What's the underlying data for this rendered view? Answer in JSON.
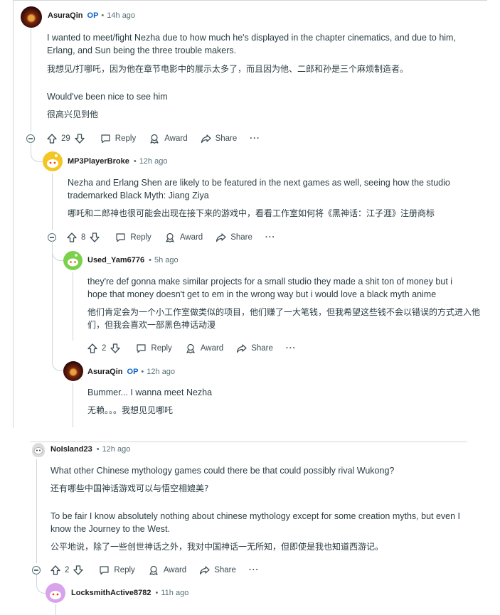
{
  "comment1": {
    "user": "AsuraQin",
    "op": "OP",
    "time": "14h ago",
    "text_en": "I wanted to meet/fight Nezha due to how much he's displayed in the chapter cinematics, and due to him, Erlang, and Sun being the three trouble makers.",
    "text_zh": "我想见/打哪吒，因为他在章节电影中的展示太多了，而且因为他、二郎和孙是三个麻烦制造者。",
    "text2_en": "Would've been nice to see him",
    "text2_zh": "很高兴见到他",
    "votes": "29",
    "reply": "Reply",
    "award": "Award",
    "share": "Share",
    "more": "···"
  },
  "comment2": {
    "user": "MP3PlayerBroke",
    "time": "12h ago",
    "text_en": "Nezha and Erlang Shen are likely to be featured in the next games as well, seeing how the studio trademarked Black Myth: Jiang Ziya",
    "text_zh": "哪吒和二郎神也很可能会出现在接下来的游戏中，看看工作室如何将《黑神话：江子涯》注册商标",
    "votes": "8",
    "reply": "Reply",
    "award": "Award",
    "share": "Share",
    "more": "···"
  },
  "comment3": {
    "user": "Used_Yam6776",
    "time": "5h ago",
    "text_en": "they're def gonna make similar projects for a small studio they made a shit ton of money but i hope that money doesn't get to em in the wrong way but i would love a black myth anime",
    "text_zh": "他们肯定会为一个小工作室做类似的项目，他们赚了一大笔钱，但我希望这些钱不会以错误的方式进入他们，但我会喜欢一部黑色神话动漫",
    "votes": "2",
    "reply": "Reply",
    "award": "Award",
    "share": "Share",
    "more": "···"
  },
  "comment4": {
    "user": "AsuraQin",
    "op": "OP",
    "time": "12h ago",
    "text_en": "Bummer... I wanna meet Nezha",
    "text_zh": "无赖。。。我想见见哪吒"
  },
  "comment5": {
    "user": "NoIsland23",
    "time": "12h ago",
    "text_en": "What other Chinese mythology games could there be that could possibly rival Wukong?",
    "text_zh": "还有哪些中国神话游戏可以与悟空相媲美?",
    "text2_en": "To be fair I know absolutely nothing about chinese mythology except for some creation myths, but even I know the Journey to the West.",
    "text2_zh": "公平地说，除了一些创世神话之外，我对中国神话一无所知，但即使是我也知道西游记。",
    "votes": "2",
    "reply": "Reply",
    "award": "Award",
    "share": "Share",
    "more": "···"
  },
  "comment6": {
    "user": "LocksmithActive8782",
    "time": "11h ago"
  },
  "colors": {
    "meta": "#576f76",
    "op": "#0a63c6",
    "thread": "#cfd6d9",
    "text": "#2a3c42"
  }
}
